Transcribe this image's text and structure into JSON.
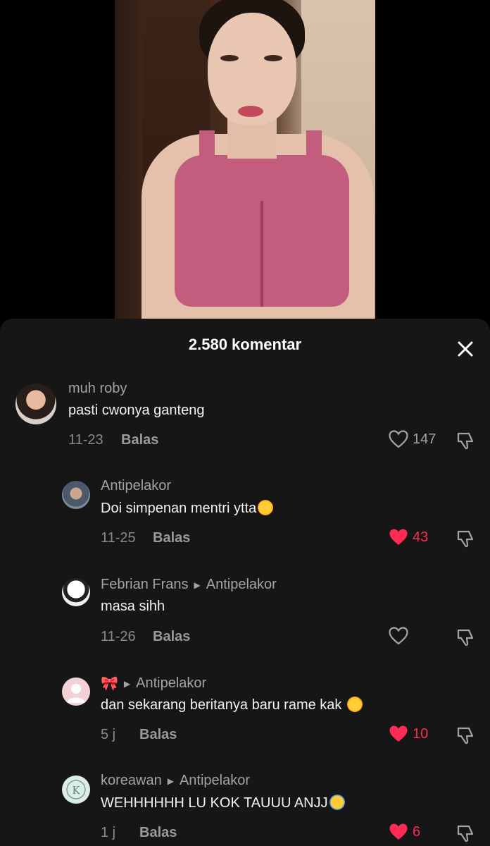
{
  "sheet": {
    "title": "2.580 komentar"
  },
  "comments": [
    {
      "username": "muh roby",
      "text": "pasti cwonya ganteng",
      "date": "11-23",
      "reply_label": "Balas",
      "likes": "147",
      "liked": false
    },
    {
      "username": "Antipelakor",
      "text": "Doi simpenan mentri ytta",
      "date": "11-25",
      "reply_label": "Balas",
      "likes": "43",
      "liked": true
    },
    {
      "username": "Febrian Frans",
      "reply_to": "Antipelakor",
      "text": "masa sihh",
      "date": "11-26",
      "reply_label": "Balas",
      "likes": "",
      "liked": false
    },
    {
      "username": "🎀",
      "reply_to": "Antipelakor",
      "text": "dan sekarang beritanya baru rame kak",
      "date": "5 j",
      "reply_label": "Balas",
      "likes": "10",
      "liked": true
    },
    {
      "username": "koreawan",
      "reply_to": "Antipelakor",
      "text": "WEHHHHHH LU KOK TAUUU ANJJ",
      "date": "1 j",
      "reply_label": "Balas",
      "likes": "6",
      "liked": true
    }
  ],
  "colors": {
    "sheet_bg": "#161616",
    "like_active": "#fe2c55",
    "muted": "#a3a3a3"
  },
  "icons": [
    "close-icon",
    "heart-icon",
    "dislike-icon",
    "reply-arrow-icon"
  ]
}
